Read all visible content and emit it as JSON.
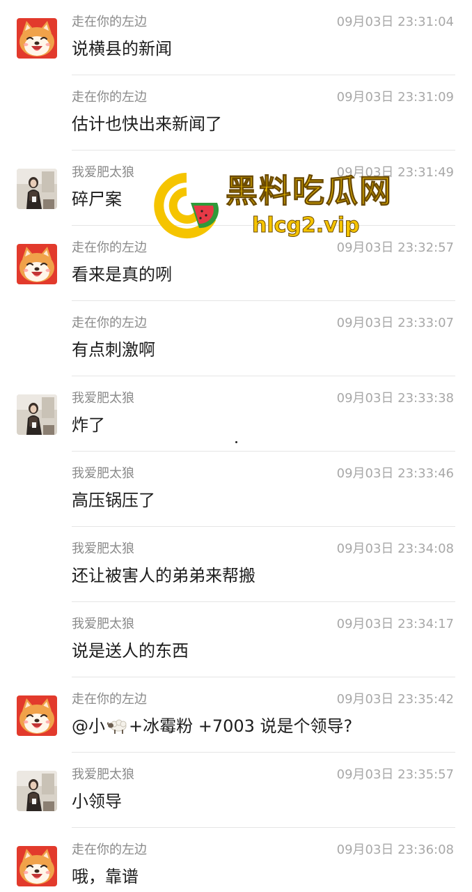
{
  "messages": [
    {
      "sender": "走在你的左边",
      "time": "09月03日 23:31:04",
      "text": "说横县的新闻",
      "avatar": "shiba-avatar"
    },
    {
      "sender": "走在你的左边",
      "time": "09月03日 23:31:09",
      "text": "估计也快出来新闻了",
      "avatar": ""
    },
    {
      "sender": "我爱肥太狼",
      "time": "09月03日 23:31:49",
      "text": "碎尸案",
      "avatar": "photo-avatar"
    },
    {
      "sender": "走在你的左边",
      "time": "09月03日 23:32:57",
      "text": "看来是真的咧",
      "avatar": "shiba-avatar"
    },
    {
      "sender": "走在你的左边",
      "time": "09月03日 23:33:07",
      "text": "有点刺激啊",
      "avatar": ""
    },
    {
      "sender": "我爱肥太狼",
      "time": "09月03日 23:33:38",
      "text": "炸了",
      "avatar": "photo-avatar"
    },
    {
      "sender": "我爱肥太狼",
      "time": "09月03日 23:33:46",
      "text": "高压锅压了",
      "avatar": ""
    },
    {
      "sender": "我爱肥太狼",
      "time": "09月03日 23:34:08",
      "text": "还让被害人的弟弟来帮搬",
      "avatar": ""
    },
    {
      "sender": "我爱肥太狼",
      "time": "09月03日 23:34:17",
      "text": "说是送人的东西",
      "avatar": ""
    },
    {
      "sender": "走在你的左边",
      "time": "09月03日 23:35:42",
      "text_before_icon": "@小",
      "text_after_icon": "+冰霉粉 +7003 说是个领导?",
      "icon": "sheep-emoji-icon",
      "avatar": "shiba-avatar"
    },
    {
      "sender": "我爱肥太狼",
      "time": "09月03日 23:35:57",
      "text": "小领导",
      "avatar": "photo-avatar"
    },
    {
      "sender": "走在你的左边",
      "time": "09月03日 23:36:08",
      "text": "哦，靠谱",
      "avatar": "shiba-avatar"
    }
  ],
  "watermark": {
    "title": "黑料吃瓜网",
    "url": "hlcg2.vip",
    "logo": "watermelon-logo-icon"
  },
  "colors": {
    "sender": "#8a8a8a",
    "time": "#a8a8a8",
    "text": "#1c1c1c",
    "divider": "#e5e5e5",
    "watermark": "#f5c400",
    "shiba_bg": "#e23a2c"
  }
}
